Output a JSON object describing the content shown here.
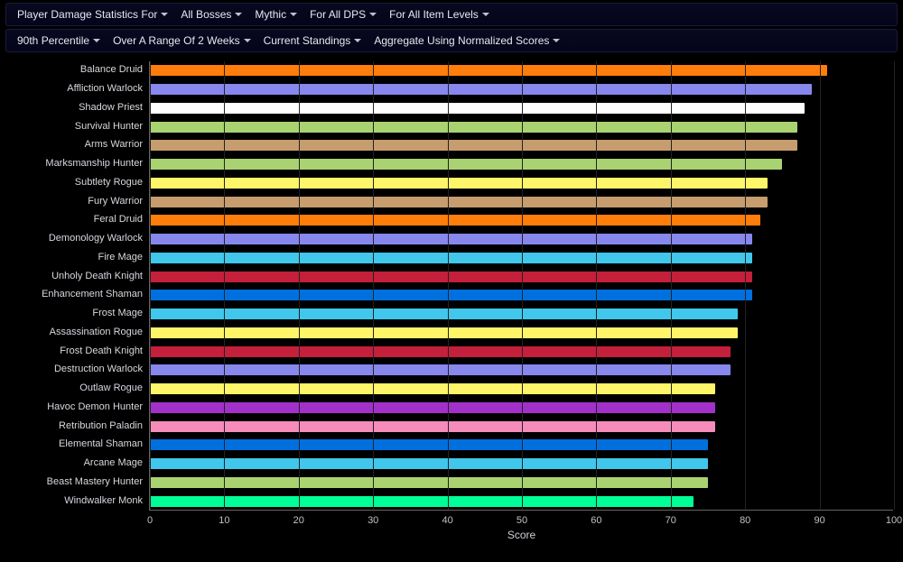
{
  "filters_row1": [
    {
      "label": "Player Damage Statistics For"
    },
    {
      "label": "All Bosses"
    },
    {
      "label": "Mythic"
    },
    {
      "label": "For All DPS"
    },
    {
      "label": "For All Item Levels"
    }
  ],
  "filters_row2": [
    {
      "label": "90th Percentile"
    },
    {
      "label": "Over A Range Of 2 Weeks"
    },
    {
      "label": "Current Standings"
    },
    {
      "label": "Aggregate Using Normalized Scores"
    }
  ],
  "chart_data": {
    "type": "bar",
    "orientation": "horizontal",
    "title": "",
    "xlabel": "Score",
    "ylabel": "",
    "xlim": [
      0,
      100
    ],
    "x_ticks": [
      0,
      10,
      20,
      30,
      40,
      50,
      60,
      70,
      80,
      90,
      100
    ],
    "categories": [
      "Balance Druid",
      "Affliction Warlock",
      "Shadow Priest",
      "Survival Hunter",
      "Arms Warrior",
      "Marksmanship Hunter",
      "Subtlety Rogue",
      "Fury Warrior",
      "Feral Druid",
      "Demonology Warlock",
      "Fire Mage",
      "Unholy Death Knight",
      "Enhancement Shaman",
      "Frost Mage",
      "Assassination Rogue",
      "Frost Death Knight",
      "Destruction Warlock",
      "Outlaw Rogue",
      "Havoc Demon Hunter",
      "Retribution Paladin",
      "Elemental Shaman",
      "Arcane Mage",
      "Beast Mastery Hunter",
      "Windwalker Monk"
    ],
    "values": [
      91,
      89,
      88,
      87,
      87,
      85,
      83,
      83,
      82,
      81,
      81,
      81,
      81,
      79,
      79,
      78,
      78,
      76,
      76,
      76,
      75,
      75,
      75,
      73
    ],
    "colors": [
      "#ff7d0a",
      "#8787ed",
      "#ffffff",
      "#a9d271",
      "#c79c6e",
      "#a9d271",
      "#fff569",
      "#c79c6e",
      "#ff7d0a",
      "#8787ed",
      "#40c7eb",
      "#c41f3b",
      "#0070de",
      "#40c7eb",
      "#fff569",
      "#c41f3b",
      "#8787ed",
      "#fff569",
      "#a330c9",
      "#f58cba",
      "#0070de",
      "#40c7eb",
      "#a9d271",
      "#00ff96"
    ]
  }
}
